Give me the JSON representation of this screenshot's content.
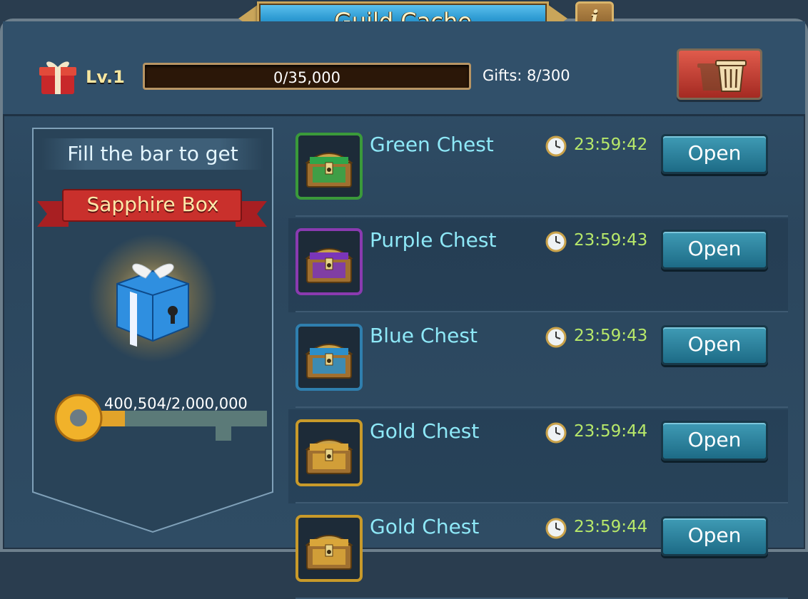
{
  "window": {
    "title": "Guild Cache",
    "info_label": "i"
  },
  "header": {
    "level": "Lv.1",
    "progress_text": "0/35,000",
    "progress_fraction": 0,
    "gifts": "Gifts: 8/300"
  },
  "reward": {
    "prompt": "Fill the bar to get",
    "box_name": "Sapphire Box",
    "key_progress": "400,504/2,000,000",
    "key_fraction": 0.2
  },
  "chests": [
    {
      "name": "Green Chest",
      "timer": "23:59:42",
      "open_label": "Open",
      "color": "#3a9a3a",
      "accent": "#2fa64a"
    },
    {
      "name": "Purple Chest",
      "timer": "23:59:43",
      "open_label": "Open",
      "color": "#8a3ab0",
      "accent": "#7a35b8"
    },
    {
      "name": "Blue Chest",
      "timer": "23:59:43",
      "open_label": "Open",
      "color": "#2f7fae",
      "accent": "#2c8fc9"
    },
    {
      "name": "Gold Chest",
      "timer": "23:59:44",
      "open_label": "Open",
      "color": "#c89a2a",
      "accent": "#d9a63a"
    },
    {
      "name": "Gold Chest",
      "timer": "23:59:44",
      "open_label": "Open",
      "color": "#c89a2a",
      "accent": "#d9a63a"
    }
  ],
  "icons": {
    "gift": "gift-icon",
    "trash": "trash-icon",
    "clock": "clock-icon",
    "key": "key-icon",
    "info": "info-icon"
  }
}
